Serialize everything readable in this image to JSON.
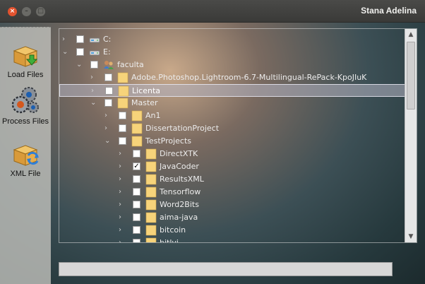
{
  "window": {
    "title": "Stana Adelina",
    "close_glyph": "×",
    "min_glyph": "–",
    "max_glyph": "□"
  },
  "sidebar": {
    "items": [
      {
        "label": "Load Files",
        "icon": "box-download-icon"
      },
      {
        "label": "Process Files",
        "icon": "gears-icon"
      },
      {
        "label": "XML File",
        "icon": "box-refresh-icon"
      }
    ]
  },
  "tree": {
    "rows": [
      {
        "label": "C:",
        "depth": 0,
        "expanded": false,
        "checked": false,
        "icon": "drive-icon",
        "selected": false
      },
      {
        "label": "E:",
        "depth": 0,
        "expanded": true,
        "checked": false,
        "icon": "drive-icon",
        "selected": false
      },
      {
        "label": "faculta",
        "depth": 1,
        "expanded": true,
        "checked": false,
        "icon": "user-folder-icon",
        "selected": false
      },
      {
        "label": "Adobe.Photoshop.Lightroom-6.7-Multilingual-RePack-KpoJIuK",
        "depth": 2,
        "expanded": false,
        "checked": false,
        "icon": "folder-icon",
        "selected": false
      },
      {
        "label": "Licenta",
        "depth": 2,
        "expanded": false,
        "checked": false,
        "icon": "folder-icon",
        "selected": true
      },
      {
        "label": "Master",
        "depth": 2,
        "expanded": true,
        "checked": false,
        "icon": "folder-icon",
        "selected": false
      },
      {
        "label": "An1",
        "depth": 3,
        "expanded": false,
        "checked": false,
        "icon": "folder-icon",
        "selected": false
      },
      {
        "label": "DissertationProject",
        "depth": 3,
        "expanded": false,
        "checked": false,
        "icon": "folder-icon",
        "selected": false
      },
      {
        "label": "TestProjects",
        "depth": 3,
        "expanded": true,
        "checked": false,
        "icon": "folder-icon",
        "selected": false
      },
      {
        "label": "DirectXTK",
        "depth": 4,
        "expanded": false,
        "checked": false,
        "icon": "folder-icon",
        "selected": false
      },
      {
        "label": "JavaCoder",
        "depth": 4,
        "expanded": false,
        "checked": true,
        "icon": "folder-icon",
        "selected": false
      },
      {
        "label": "ResultsXML",
        "depth": 4,
        "expanded": false,
        "checked": false,
        "icon": "folder-icon",
        "selected": false
      },
      {
        "label": "Tensorflow",
        "depth": 4,
        "expanded": false,
        "checked": false,
        "icon": "folder-icon",
        "selected": false
      },
      {
        "label": "Word2Bits",
        "depth": 4,
        "expanded": false,
        "checked": false,
        "icon": "folder-icon",
        "selected": false
      },
      {
        "label": "aima-java",
        "depth": 4,
        "expanded": false,
        "checked": false,
        "icon": "folder-icon",
        "selected": false
      },
      {
        "label": "bitcoin",
        "depth": 4,
        "expanded": false,
        "checked": false,
        "icon": "folder-icon",
        "selected": false
      },
      {
        "label": "bitlyi",
        "depth": 4,
        "expanded": false,
        "checked": false,
        "icon": "folder-icon",
        "selected": false
      }
    ],
    "scroll_up_glyph": "▲",
    "scroll_down_glyph": "▼",
    "collapsed_glyph": "›",
    "expanded_glyph": "⌄",
    "check_glyph": "✓"
  },
  "progress": {
    "value": 0
  },
  "colors": {
    "folder": "#f6d37a",
    "selection": "#b4b4c3",
    "close": "#e3532f"
  }
}
